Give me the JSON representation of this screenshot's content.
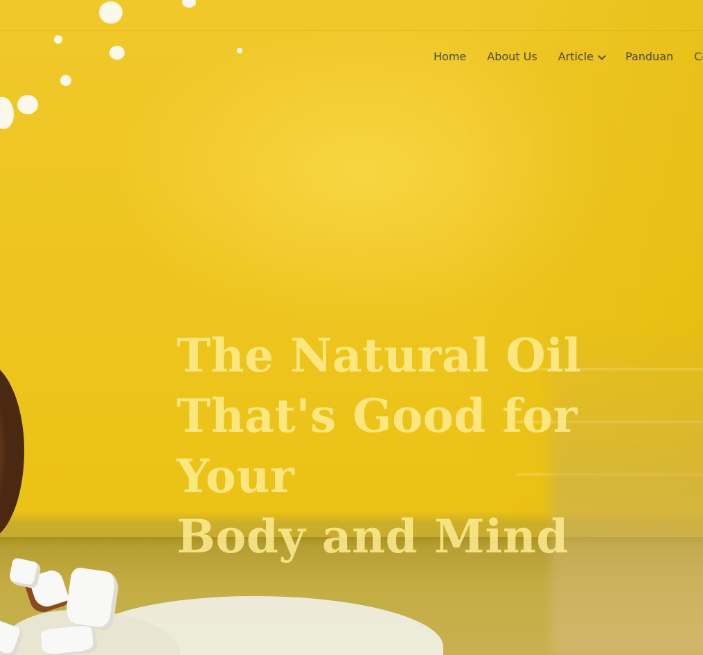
{
  "nav": {
    "items": [
      {
        "label": "Home",
        "has_dropdown": false
      },
      {
        "label": "About Us",
        "has_dropdown": false
      },
      {
        "label": "Article",
        "has_dropdown": true
      },
      {
        "label": "Panduan",
        "has_dropdown": false
      },
      {
        "label": "Co",
        "has_dropdown": false
      }
    ]
  },
  "hero": {
    "headline_lines": [
      "The Natural Oil",
      "That's Good for Your",
      "Body and Mind"
    ]
  },
  "colors": {
    "background": "#eec520",
    "headline": "#fff096",
    "nav_text": "#4b4b3a"
  },
  "icons": {
    "dropdown": "chevron-down-icon"
  }
}
